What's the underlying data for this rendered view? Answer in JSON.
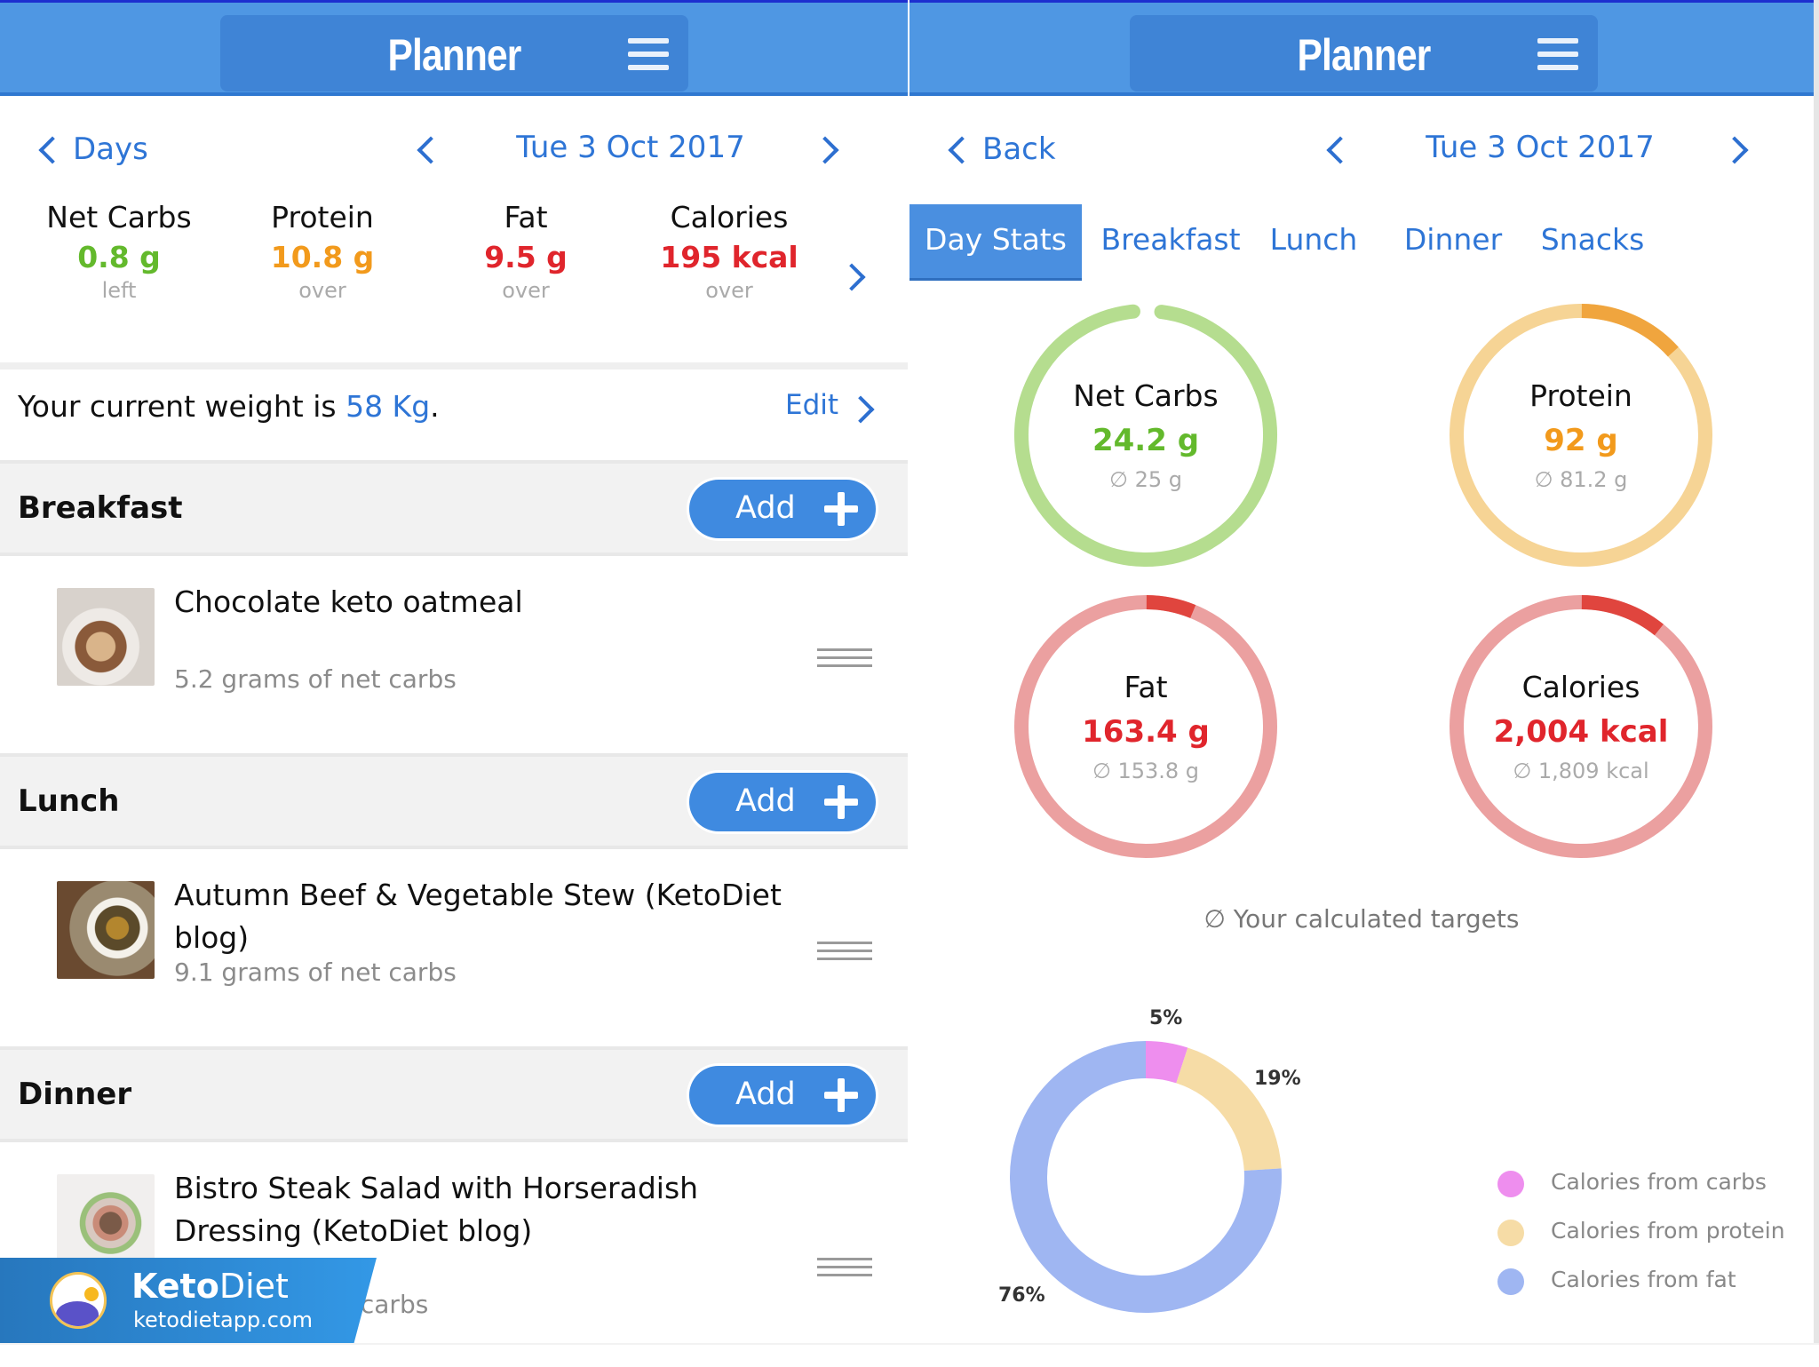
{
  "colors": {
    "header_bg": "#4f97e3",
    "title_pill": "#3f84d6",
    "link_blue": "#2e75d6",
    "green": "#63b92c",
    "orange": "#f29a1c",
    "red": "#e0252c",
    "green_ring": "#b5dd8f",
    "orange_ring": "#f6d495",
    "orange_ring_over": "#f0a53e",
    "red_ring": "#eba0a0",
    "red_ring_over": "#e0453e",
    "pie_carbs": "#ee8eee",
    "pie_protein": "#f6dca6",
    "pie_fat": "#9fb6f2"
  },
  "left": {
    "header": {
      "title": "Planner",
      "menu_icon": "hamburger-menu-icon"
    },
    "nav": {
      "back_label": "Days",
      "date": "Tue 3 Oct 2017"
    },
    "macros": [
      {
        "name": "Net Carbs",
        "value": "0.8 g",
        "status": "left",
        "color": "green"
      },
      {
        "name": "Protein",
        "value": "10.8 g",
        "status": "over",
        "color": "orange"
      },
      {
        "name": "Fat",
        "value": "9.5 g",
        "status": "over",
        "color": "red"
      },
      {
        "name": "Calories",
        "value": "195 kcal",
        "status": "over",
        "color": "red"
      }
    ],
    "weight": {
      "prefix": "Your current weight is ",
      "value": "58 Kg",
      "suffix": ".",
      "edit_label": "Edit"
    },
    "meals": [
      {
        "title": "Breakfast",
        "add_label": "Add",
        "items": [
          {
            "name": "Chocolate keto oatmeal",
            "subtitle": "5.2 grams of net carbs"
          }
        ]
      },
      {
        "title": "Lunch",
        "add_label": "Add",
        "items": [
          {
            "name": "Autumn Beef & Vegetable Stew (KetoDiet blog)",
            "subtitle": "9.1 grams of net carbs"
          }
        ]
      },
      {
        "title": "Dinner",
        "add_label": "Add",
        "items": [
          {
            "name": "Bistro Steak Salad with Horseradish Dressing (KetoDiet blog)",
            "subtitle": "t carbs"
          }
        ]
      }
    ],
    "brand": {
      "name_bold": "Keto",
      "name_light": "Diet",
      "url": "ketodietapp.com"
    }
  },
  "right": {
    "header": {
      "title": "Planner",
      "menu_icon": "hamburger-menu-icon"
    },
    "nav": {
      "back_label": "Back",
      "date": "Tue 3 Oct 2017"
    },
    "tabs": [
      {
        "label": "Day Stats",
        "active": true
      },
      {
        "label": "Breakfast",
        "active": false
      },
      {
        "label": "Lunch",
        "active": false
      },
      {
        "label": "Dinner",
        "active": false
      },
      {
        "label": "Snacks",
        "active": false
      }
    ],
    "rings": [
      {
        "name": "Net Carbs",
        "value": "24.2 g",
        "target": "∅ 25 g",
        "progress": 0.968,
        "over": 0,
        "color": "green"
      },
      {
        "name": "Protein",
        "value": "92 g",
        "target": "∅ 81.2 g",
        "progress": 1.0,
        "over": 0.133,
        "color": "orange"
      },
      {
        "name": "Fat",
        "value": "163.4 g",
        "target": "∅ 153.8 g",
        "progress": 1.0,
        "over": 0.062,
        "color": "red"
      },
      {
        "name": "Calories",
        "value": "2,004 kcal",
        "target": "∅ 1,809 kcal",
        "progress": 1.0,
        "over": 0.108,
        "color": "red"
      }
    ],
    "targets_note": "∅ Your calculated targets"
  },
  "chart_data": {
    "type": "pie",
    "title": "",
    "donut": true,
    "categories": [
      "Calories from carbs",
      "Calories from protein",
      "Calories from fat"
    ],
    "values": [
      5,
      19,
      76
    ],
    "labels": [
      "5%",
      "19%",
      "76%"
    ],
    "colors": [
      "#ee8eee",
      "#f6dca6",
      "#9fb6f2"
    ],
    "legend": "right"
  }
}
